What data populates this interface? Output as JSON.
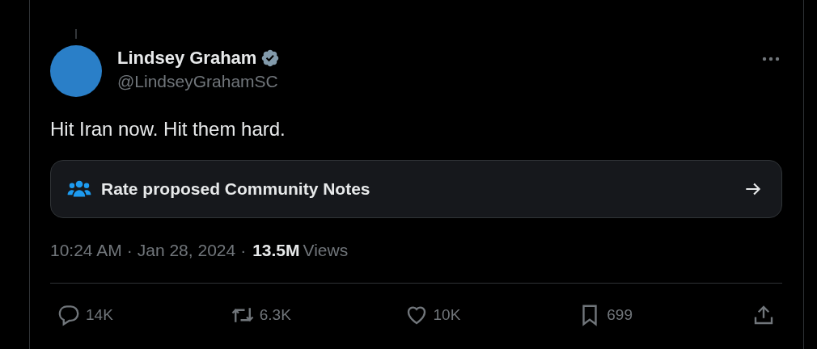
{
  "author": {
    "name": "Lindsey Graham",
    "verified": true,
    "handle": "@LindseyGrahamSC"
  },
  "text": "Hit Iran now. Hit them hard.",
  "notes_prompt": {
    "label": "Rate proposed Community Notes"
  },
  "meta": {
    "time": "10:24 AM",
    "separator_1": "·",
    "date": "Jan 28, 2024",
    "separator_2": "·",
    "views": "13.5M",
    "views_label": "Views"
  },
  "actions": [
    {
      "kind": "reply",
      "count": "14K"
    },
    {
      "kind": "repost",
      "count": "6.3K"
    },
    {
      "kind": "like",
      "count": "10K"
    },
    {
      "kind": "bookmark",
      "count": "699"
    },
    {
      "kind": "share"
    }
  ]
}
